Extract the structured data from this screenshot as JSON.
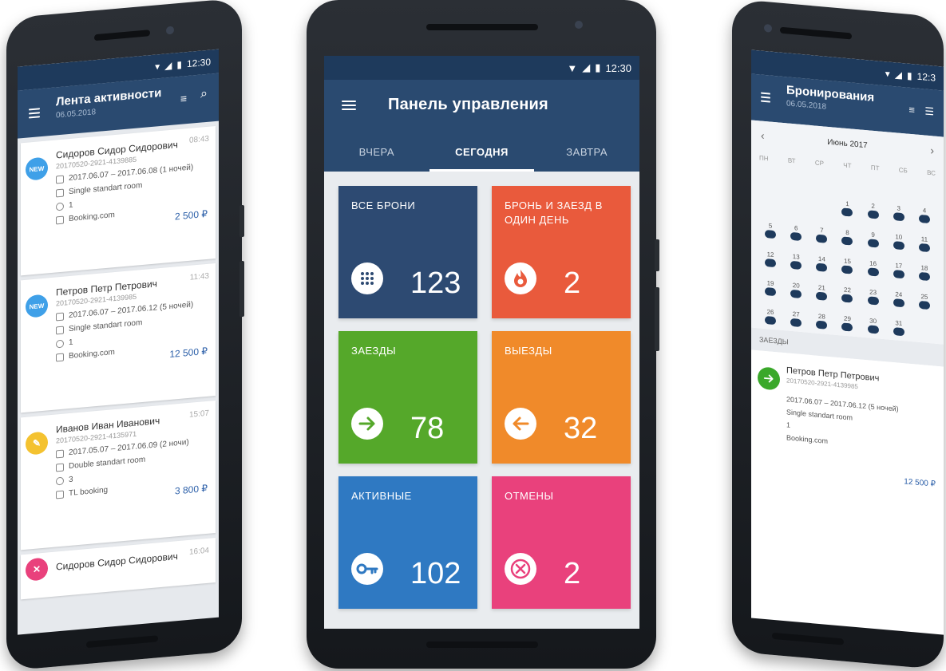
{
  "status": {
    "time": "12:30",
    "time_short": "12:3"
  },
  "center": {
    "title": "Панель управления",
    "tabs": [
      {
        "label": "ВЧЕРА"
      },
      {
        "label": "СЕГОДНЯ"
      },
      {
        "label": "ЗАВТРА"
      }
    ],
    "active_tab": "СЕГОДНЯ",
    "tiles": [
      {
        "label": "ВСЕ БРОНИ",
        "count": "123",
        "color": "#2d4a72",
        "icon": "grid-dots-icon"
      },
      {
        "label": "БРОНЬ И ЗАЕЗД В ОДИН ДЕНЬ",
        "count": "2",
        "color": "#e95a3c",
        "icon": "fire-icon"
      },
      {
        "label": "ЗАЕЗДЫ",
        "count": "78",
        "color": "#55a82a",
        "icon": "arrow-right-icon"
      },
      {
        "label": "ВЫЕЗДЫ",
        "count": "32",
        "color": "#f08a2a",
        "icon": "arrow-left-icon"
      },
      {
        "label": "АКТИВНЫЕ",
        "count": "102",
        "color": "#2f79c2",
        "icon": "key-icon"
      },
      {
        "label": "ОТМЕНЫ",
        "count": "2",
        "color": "#e9417c",
        "icon": "cancel-icon"
      }
    ]
  },
  "left": {
    "title": "Лента активности",
    "date": "06.05.2018",
    "cards": [
      {
        "name": "Сидоров Сидор Сидорович",
        "id": "20170520-2921-4139885",
        "time": "08:43",
        "dates": "2017.06.07 – 2017.06.08 (1 ночей)",
        "room": "Single standart room",
        "guests": "1",
        "source": "Booking.com",
        "price": "2 500 ₽",
        "avatar": "NEW",
        "avatar_color": "#3fa0e8"
      },
      {
        "name": "Петров Петр Петрович",
        "id": "20170520-2921-4139985",
        "time": "11:43",
        "dates": "2017.06.07 – 2017.06.12 (5 ночей)",
        "room": "Single standart room",
        "guests": "1",
        "source": "Booking.com",
        "price": "12 500 ₽",
        "avatar": "NEW",
        "avatar_color": "#3fa0e8"
      },
      {
        "name": "Иванов Иван Иванович",
        "id": "20170520-2921-4135971",
        "time": "15:07",
        "dates": "2017.05.07 – 2017.06.09 (2 ночи)",
        "room": "Double standart room",
        "guests": "3",
        "source": "TL booking",
        "price": "3 800 ₽",
        "avatar": "✎",
        "avatar_color": "#f4c230"
      },
      {
        "name": "Сидоров Сидор Сидорович",
        "id": "",
        "time": "16:04",
        "dates": "",
        "room": "",
        "guests": "",
        "source": "",
        "price": "",
        "avatar": "✕",
        "avatar_color": "#e9417c"
      }
    ]
  },
  "right": {
    "title": "Бронирования",
    "date": "06.05.2018",
    "month": "Июнь 2017",
    "weekdays": [
      "ПН",
      "ВТ",
      "СР",
      "ЧТ",
      "ПТ",
      "СБ",
      "ВС"
    ],
    "section": "ЗАЕЗДЫ",
    "card": {
      "name": "Петров Петр Петрович",
      "id": "20170520-2921-4139985",
      "dates": "2017.06.07 – 2017.06.12 (5 ночей)",
      "room": "Single standart room",
      "guests": "1",
      "source": "Booking.com",
      "price": "12 500 ₽"
    }
  }
}
